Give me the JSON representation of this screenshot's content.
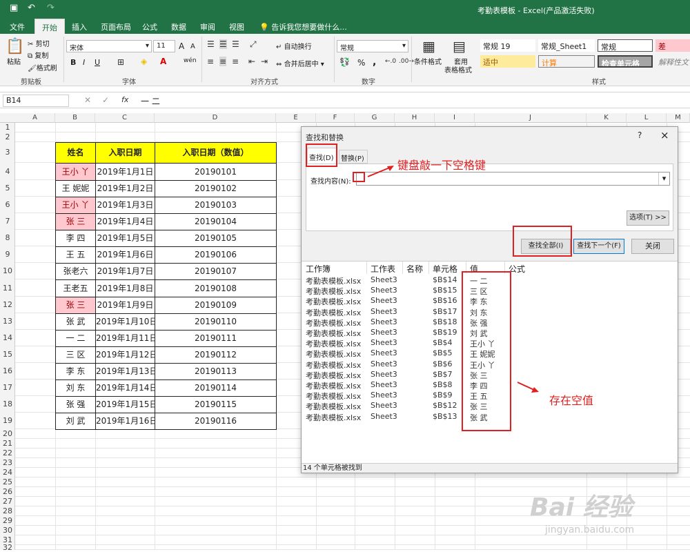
{
  "titlebar": {
    "title": "考勤表模板 - Excel(产品激活失败)",
    "save_icon": "▣",
    "undo_icon": "↶",
    "redo_icon": "↷"
  },
  "tabs": [
    "文件",
    "开始",
    "插入",
    "页面布局",
    "公式",
    "数据",
    "审阅",
    "视图"
  ],
  "tell_me": "告诉我您想要做什么...",
  "ribbon": {
    "clipboard": {
      "paste": "粘贴",
      "cut": "剪切",
      "copy": "复制",
      "format_painter": "格式刷",
      "label": "剪贴板"
    },
    "font": {
      "name": "宋体",
      "size": "11",
      "bold": "B",
      "italic": "I",
      "underline": "U",
      "label": "字体",
      "grow": "A",
      "shrink": "A",
      "wen": "wén"
    },
    "alignment": {
      "wrap": "自动换行",
      "merge": "合并后居中",
      "label": "对齐方式"
    },
    "number": {
      "format": "常规",
      "percent": "%",
      "comma": ",",
      "label": "数字"
    },
    "styles": {
      "conditional": "条件格式",
      "table_format_1": "套用",
      "table_format_2": "表格格式",
      "label": "样式",
      "cells": [
        "常规 19",
        "常规_Sheet1",
        "常规",
        "差",
        "适中",
        "计算",
        "检查单元格",
        "解释性文"
      ]
    }
  },
  "formula_bar": {
    "name_box": "B14",
    "value": "一 二",
    "fx": "fx"
  },
  "columns": [
    "A",
    "B",
    "C",
    "D",
    "E",
    "F",
    "G",
    "H",
    "I",
    "J",
    "K",
    "L",
    "M"
  ],
  "rows": [
    "1",
    "2",
    "3",
    "4",
    "5",
    "6",
    "7",
    "8",
    "9",
    "10",
    "11",
    "12",
    "13",
    "14",
    "15",
    "16",
    "17",
    "18",
    "19",
    "20",
    "21",
    "22",
    "23",
    "24",
    "25",
    "26",
    "27",
    "28",
    "29",
    "30",
    "31",
    "32"
  ],
  "table": {
    "headers": [
      "姓名",
      "入职日期",
      "入职日期（数值）"
    ],
    "rows": [
      [
        "王小 丫",
        "2019年1月1日",
        "20190101"
      ],
      [
        "王 妮妮",
        "2019年1月2日",
        "20190102"
      ],
      [
        "王小 丫",
        "2019年1月3日",
        "20190103"
      ],
      [
        "张 三",
        "2019年1月4日",
        "20190104"
      ],
      [
        "李 四",
        "2019年1月5日",
        "20190105"
      ],
      [
        "王 五",
        "2019年1月6日",
        "20190106"
      ],
      [
        "张老六",
        "2019年1月7日",
        "20190107"
      ],
      [
        "王老五",
        "2019年1月8日",
        "20190108"
      ],
      [
        "张 三",
        "2019年1月9日",
        "20190109"
      ],
      [
        "张 武",
        "2019年1月10日",
        "20190110"
      ],
      [
        "一 二",
        "2019年1月11日",
        "20190111"
      ],
      [
        "三 区",
        "2019年1月12日",
        "20190112"
      ],
      [
        "李 东",
        "2019年1月13日",
        "20190113"
      ],
      [
        "刘 东",
        "2019年1月14日",
        "20190114"
      ],
      [
        "张 强",
        "2019年1月15日",
        "20190115"
      ],
      [
        "刘 武",
        "2019年1月16日",
        "20190116"
      ]
    ],
    "highlighted": [
      0,
      2,
      3,
      8
    ]
  },
  "dialog": {
    "title": "查找和替换",
    "help": "?",
    "close": "×",
    "tab_find": "查找(D)",
    "tab_replace": "替换(P)",
    "find_label": "查找内容(N):",
    "options": "选项(T) >>",
    "find_all": "查找全部(I)",
    "find_next": "查找下一个(F)",
    "close_btn": "关闭",
    "result_headers": [
      "工作簿",
      "工作表",
      "名称",
      "单元格",
      "值",
      "公式"
    ],
    "results": [
      [
        "考勤表模板.xlsx",
        "Sheet3",
        "",
        "$B$14",
        "一 二"
      ],
      [
        "考勤表模板.xlsx",
        "Sheet3",
        "",
        "$B$15",
        "三 区"
      ],
      [
        "考勤表模板.xlsx",
        "Sheet3",
        "",
        "$B$16",
        "李 东"
      ],
      [
        "考勤表模板.xlsx",
        "Sheet3",
        "",
        "$B$17",
        "刘 东"
      ],
      [
        "考勤表模板.xlsx",
        "Sheet3",
        "",
        "$B$18",
        "张 强"
      ],
      [
        "考勤表模板.xlsx",
        "Sheet3",
        "",
        "$B$19",
        "刘 武"
      ],
      [
        "考勤表模板.xlsx",
        "Sheet3",
        "",
        "$B$4",
        "王小 丫"
      ],
      [
        "考勤表模板.xlsx",
        "Sheet3",
        "",
        "$B$5",
        "王 妮妮"
      ],
      [
        "考勤表模板.xlsx",
        "Sheet3",
        "",
        "$B$6",
        "王小 丫"
      ],
      [
        "考勤表模板.xlsx",
        "Sheet3",
        "",
        "$B$7",
        "张 三"
      ],
      [
        "考勤表模板.xlsx",
        "Sheet3",
        "",
        "$B$8",
        "李 四"
      ],
      [
        "考勤表模板.xlsx",
        "Sheet3",
        "",
        "$B$9",
        "王 五"
      ],
      [
        "考勤表模板.xlsx",
        "Sheet3",
        "",
        "$B$12",
        "张 三"
      ],
      [
        "考勤表模板.xlsx",
        "Sheet3",
        "",
        "$B$13",
        "张 武"
      ]
    ],
    "status": "14 个单元格被找到"
  },
  "annotations": {
    "keyboard": "键盘敲一下空格键",
    "has_space": "存在空值"
  },
  "watermark": {
    "logo": "Bai 经验",
    "url": "jingyan.baidu.com"
  },
  "colors": {
    "excel_green": "#217346",
    "highlight_pink": "#ffc7ce",
    "header_yellow": "#ffff00",
    "annotation_red": "#e02020"
  }
}
